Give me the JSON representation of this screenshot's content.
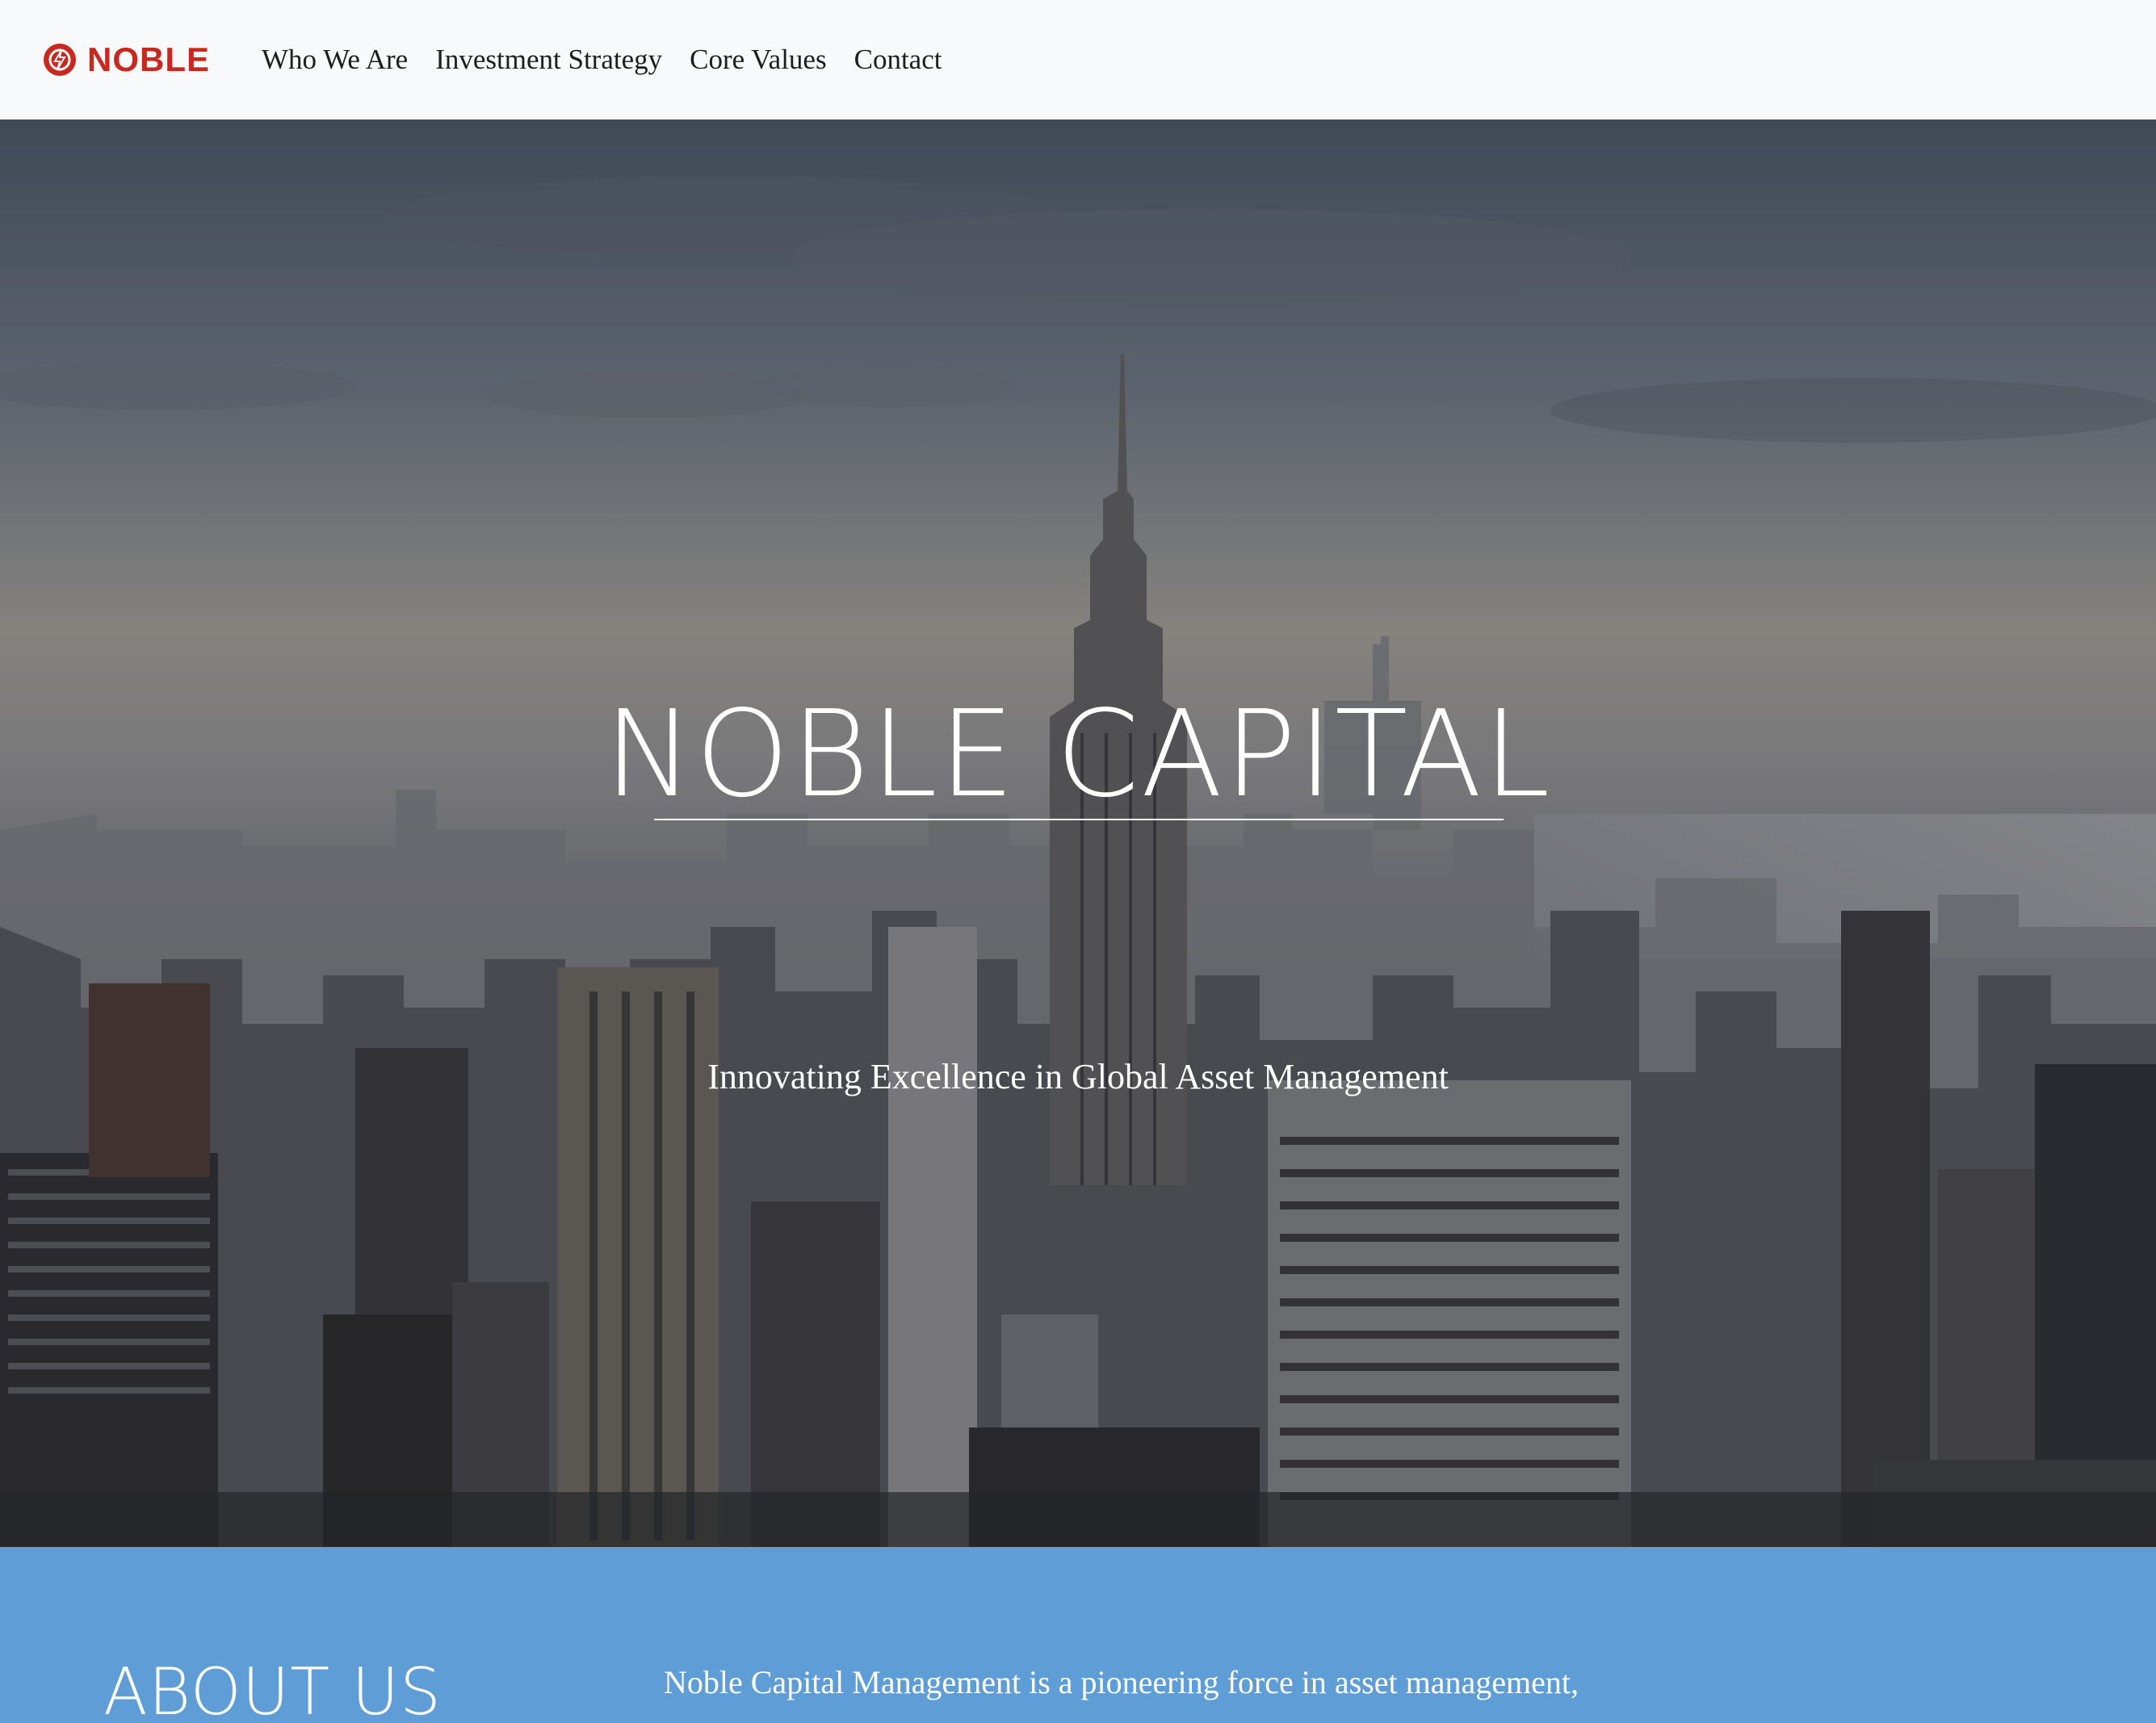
{
  "nav": {
    "logo_text": "NOBLE",
    "links": [
      "Who We Are",
      "Investment Strategy",
      "Core Values",
      "Contact"
    ]
  },
  "hero": {
    "title": "NOBLE CAPITAL",
    "subtitle": "Innovating Excellence in Global Asset Management"
  },
  "about": {
    "heading": "ABOUT US",
    "text": "Noble Capital Management is a pioneering force in asset management,"
  },
  "colors": {
    "brand_red": "#c8281e",
    "about_blue": "#5f9dd6",
    "nav_bg": "#f8f9fb"
  },
  "icons": {
    "logo": "noble-logo-icon"
  }
}
